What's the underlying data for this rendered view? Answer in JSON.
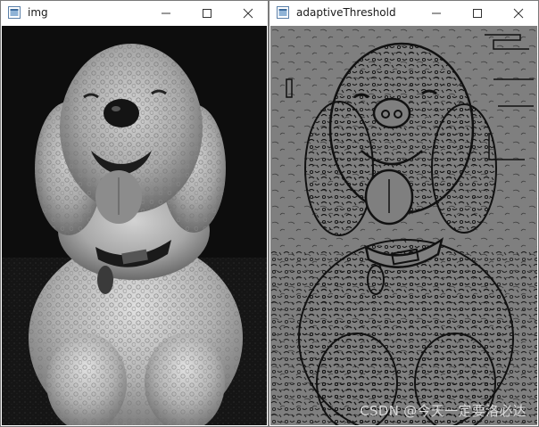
{
  "windows": [
    {
      "title": "img",
      "content": "grayscale photograph of a curly-coated poodle sitting, tongue out, dark background"
    },
    {
      "title": "adaptiveThreshold",
      "content": "adaptive-threshold binarization of the same poodle photo: black noisy edge strokes on gray"
    }
  ],
  "controls": [
    "minimize-icon",
    "maximize-icon",
    "close-icon"
  ],
  "watermark": "CSDN @今天一定要洛必达",
  "colors": {
    "titlebar_bg": "#ffffff",
    "left_bg": "#0d0d0d",
    "right_bg": "#7f7f7f",
    "edge_ink": "#111111"
  }
}
